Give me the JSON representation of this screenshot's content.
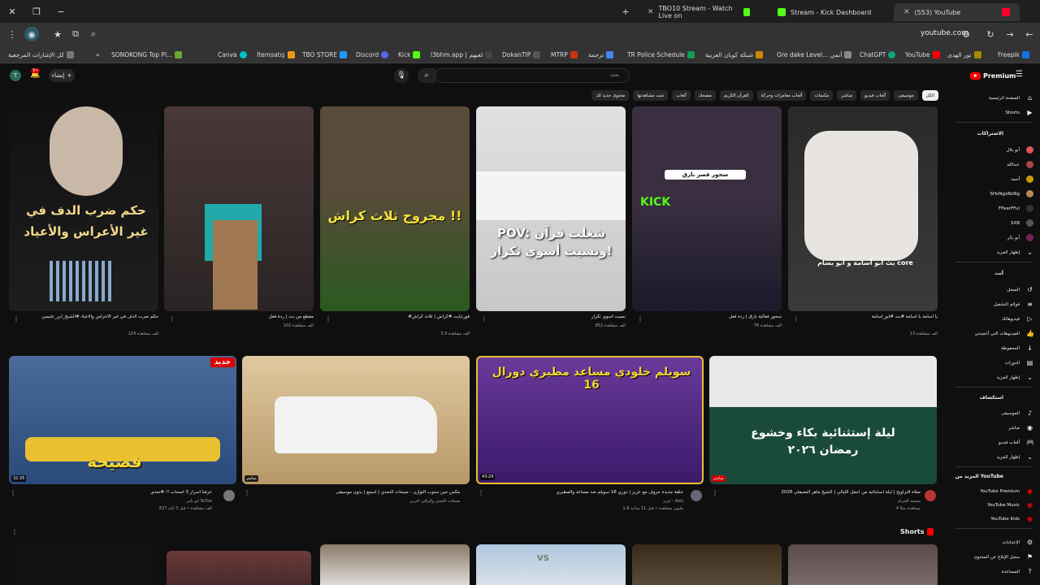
{
  "browser": {
    "tabs": [
      {
        "label": "TBO10 Stream - Watch Live on",
        "color": "#53fc18"
      },
      {
        "label": "Stream - Kick Dashboard",
        "color": "#53fc18"
      },
      {
        "label": "(553) YouTube",
        "color": "#ff0033"
      }
    ],
    "url": "youtube.com",
    "bookmarks": [
      {
        "label": "كل الإشارات المرجعية",
        "color": "#777"
      },
      {
        "label": "SONOKONG Top Pl...",
        "color": "#6a3"
      },
      {
        "label": "Canva",
        "color": "#00c4cc"
      },
      {
        "label": "İtemsatış",
        "color": "#e91"
      },
      {
        "label": "TBO STORE",
        "color": "#29f"
      },
      {
        "label": "Discord",
        "color": "#5865f2"
      },
      {
        "label": "Kick",
        "color": "#53fc18"
      },
      {
        "label": "l3bhm.app | لعبهم",
        "color": "#444"
      },
      {
        "label": "DokanTIP",
        "color": "#555"
      },
      {
        "label": "MTRP",
        "color": "#c31"
      },
      {
        "label": "ترجمة",
        "color": "#4285f4"
      },
      {
        "label": "TR Police Schedule",
        "color": "#0f9d58"
      },
      {
        "label": "شبكة كوبان العربية",
        "color": "#c80"
      },
      {
        "label": "Ore dake Level... أنمي",
        "color": "#888"
      },
      {
        "label": "ChatGPT",
        "color": "#10a37f"
      },
      {
        "label": "YouTube",
        "color": "#f00"
      },
      {
        "label": "نور الهدى",
        "color": "#a80"
      },
      {
        "label": "Freepik",
        "color": "#1273eb"
      }
    ]
  },
  "header": {
    "search_placeholder": "بحث",
    "create_label": "إنشاء",
    "logo": "Premium",
    "notif_count": "9+"
  },
  "chips": [
    "الكل",
    "موسيقى",
    "ألعاب فيديو",
    "مباشر",
    "مكسات",
    "ألعاب مغامرات وحركة",
    "القرآن الكريم",
    "مضحك",
    "مقاطع تم تحميلها مؤخرًا",
    "ألعاب",
    "تمت مشاهدتها",
    "محتوى جديد لك"
  ],
  "sidebar": {
    "home": "الصفحة الرئيسية",
    "shorts": "Shorts",
    "subs_head": "الاشتراكات",
    "subs": [
      "أبو بلال",
      "عبدالله",
      "أحمد",
      "SHoNgxBoNg",
      "FFearFFul",
      "SXB",
      "أبو بكر",
      "إظهار المزيد"
    ],
    "you_head": "أنت",
    "you": [
      "السجل",
      "قوائم التشغيل",
      "فيديوهاتك",
      "الفيديوهات التي أعجبتني",
      "المحفوظة",
      "الدورات",
      "إظهار المزيد"
    ],
    "explore_head": "استكشاف",
    "explore": [
      "الموسيقى",
      "مباشر",
      "ألعاب فيديو",
      "إظهار المزيد"
    ],
    "more_head": "المزيد من YouTube",
    "more": [
      "YouTube Premium",
      "YouTube Music",
      "YouTube Kids"
    ],
    "settings": [
      "الإعدادات",
      "سجل الإبلاغ عن المحتوى",
      "المساعدة",
      "إرسال ملاحظات"
    ]
  },
  "row1": [
    {
      "overlay": "حكم ضرب الدف في غير الأعراس والأعياد",
      "title": "حكم ضرب الدف في غير الأعراس والأعياد #الشيخ_ابن_عثيمين",
      "meta": "124 ألف مشاهدة",
      "bg": "#1a1a1a"
    },
    {
      "overlay": "",
      "title": "مقطع من بث | ردة فعل",
      "meta": "102 ألف مشاهدة",
      "bg": "#3a2c2c"
    },
    {
      "overlay": "مجروح ثلاث كراش !!",
      "title": "#فورتنايت #كراش | ثلاث كراش",
      "meta": "3.9 ألف مشاهدة",
      "bg": "#2d4a20"
    },
    {
      "overlay": "POV: شغلت قرآن ونسيت أسوي تكرار!",
      "title": "نسيت أسوي تكرار",
      "meta": "852 ألف مشاهدة",
      "bg": "#d8d8d8"
    },
    {
      "overlay": "سحور قصر بارق",
      "title": "سحور فعالية بارق | ردة فعل",
      "meta": "76 ألف مشاهدة",
      "bg": "#3a2f40"
    },
    {
      "overlay": "بث أبو أسامة و أبو بسام core",
      "title": "يا أسامة يا أسامة #بث #أبو_أسامة",
      "meta": "13 ألف مشاهدة",
      "bg": "#2a2a2a"
    }
  ],
  "row2": [
    {
      "overlay": "فضيحة",
      "badge": "جديد",
      "title": "عرفنا أسرار 3 أصحاب !! #تحدي",
      "channel": "أبو تامر Ta7oo",
      "meta": "827 ألف مشاهدة • قبل 3 أيام",
      "duration": "32:35",
      "bg": "#3a5a8a"
    },
    {
      "overlay": "",
      "title": "مكس حين ستوب التوازن - صيحات التحدي | اسمع | بدون موسيقى",
      "channel": "صيحات الحجي والرافي أخرين",
      "meta": "",
      "duration": "مباشر",
      "bg": "#c8a878"
    },
    {
      "overlay": "سويلم خلودي مساعد مطيري دورال 16",
      "title": "حلقة جديدة حروف مع عزيز | دوري 16 سويلم ضد مساعد والمطيري",
      "channel": "عزيز - Aziz",
      "meta": "1.8 مليون مشاهدة • قبل 11 ساعة",
      "duration": "43:29",
      "bg": "#5a2a8a"
    },
    {
      "overlay": "ليلة إستثنائية بكاء وخشوع رمضان ٢٠٢٦",
      "title": "صلاة التراويح | ليلة استثنائية من أجمل الليالي | الشيخ ماهر المعيقلي 2026",
      "channel": "مسجد الحرام",
      "meta": "4 مشاهدة مثلاً",
      "duration": "مباشر",
      "bg": "#1a3a2a"
    }
  ],
  "shorts_label": "Shorts"
}
